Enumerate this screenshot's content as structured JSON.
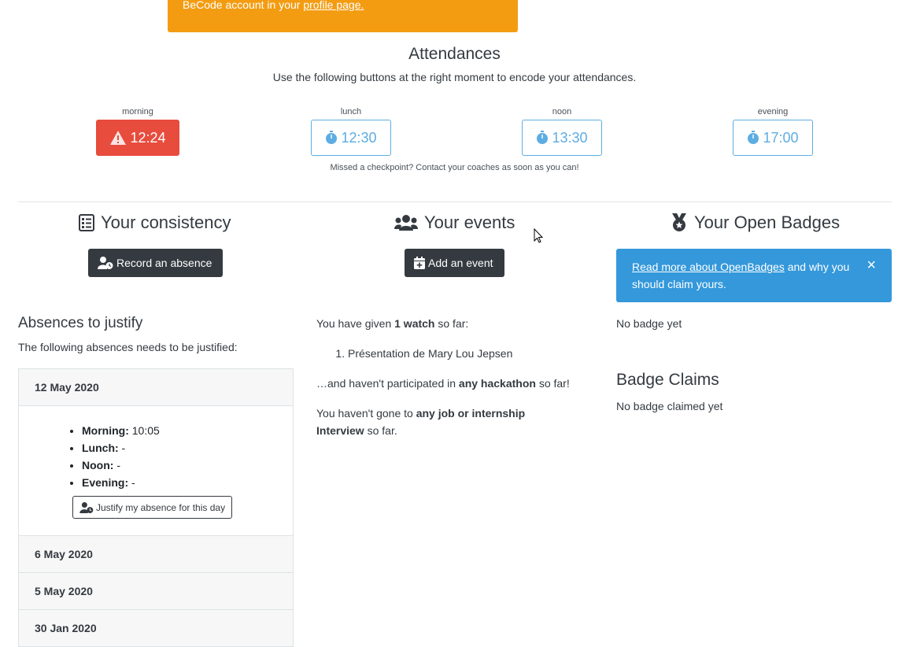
{
  "banner": {
    "text": "BeCode account in your",
    "link": "profile page."
  },
  "attendances": {
    "title": "Attendances",
    "subtitle": "Use the following buttons at the right moment to encode your attendances.",
    "checkpoints": [
      {
        "label": "morning",
        "time": "12:24",
        "status": "late",
        "icon": "warning-icon"
      },
      {
        "label": "lunch",
        "time": "12:30",
        "status": "pending",
        "icon": "stopwatch-icon"
      },
      {
        "label": "noon",
        "time": "13:30",
        "status": "pending",
        "icon": "stopwatch-icon"
      },
      {
        "label": "evening",
        "time": "17:00",
        "status": "pending",
        "icon": "stopwatch-icon"
      }
    ],
    "missed": "Missed a checkpoint? Contact your coaches as soon as you can!"
  },
  "consistency": {
    "title": "Your consistency",
    "record_button": "Record an absence",
    "absences_title": "Absences to justify",
    "absences_desc": "The following absences needs to be justified:",
    "absences": [
      {
        "date": "12 May 2020",
        "expanded": true,
        "morning_label": "Morning:",
        "morning": "10:05",
        "lunch_label": "Lunch:",
        "lunch": "-",
        "noon_label": "Noon:",
        "noon": "-",
        "evening_label": "Evening:",
        "evening": "-",
        "justify_button": "Justify my absence for this day"
      },
      {
        "date": "6 May 2020"
      },
      {
        "date": "5 May 2020"
      },
      {
        "date": "30 Jan 2020"
      }
    ]
  },
  "events": {
    "title": "Your events",
    "add_button": "Add an event",
    "given_pre": "You have given",
    "given_count": "1 watch",
    "given_post": "so far:",
    "watches": [
      "Présentation de Mary Lou Jepsen"
    ],
    "hack_pre": "…and haven't participated in",
    "hack_bold": "any hackathon",
    "hack_post": "so far!",
    "job_pre": "You haven't gone to",
    "job_bold": "any job or internship Interview",
    "job_post": "so far."
  },
  "badges": {
    "title": "Your Open Badges",
    "alert_link": "Read more about OpenBadges",
    "alert_text": "and why you should claim yours.",
    "alert_close": "×",
    "no_badge": "No badge yet",
    "claims_title": "Badge Claims",
    "no_claims": "No badge claimed yet"
  },
  "colors": {
    "banner": "#f39c12",
    "late": "#e74c3c",
    "pending": "#5dade2",
    "info": "#3498db",
    "dark": "#343a40"
  }
}
